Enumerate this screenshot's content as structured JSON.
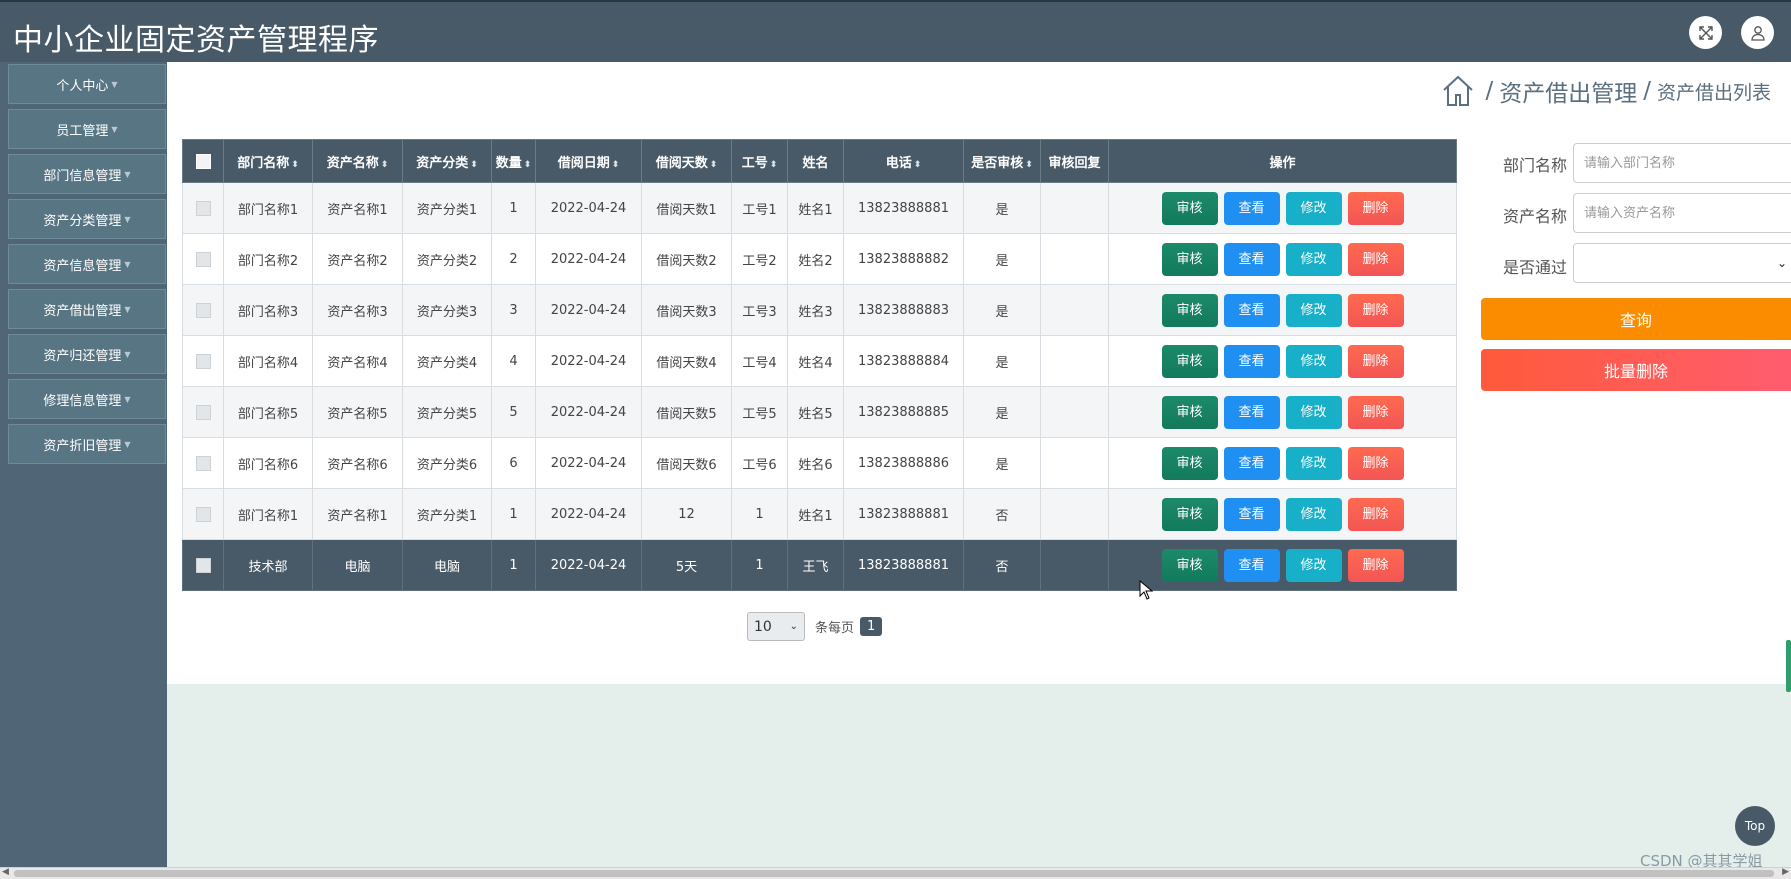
{
  "header": {
    "title": "中小企业固定资产管理程序"
  },
  "sidebar": {
    "items": [
      {
        "label": "个人中心"
      },
      {
        "label": "员工管理"
      },
      {
        "label": "部门信息管理"
      },
      {
        "label": "资产分类管理"
      },
      {
        "label": "资产信息管理"
      },
      {
        "label": "资产借出管理"
      },
      {
        "label": "资产归还管理"
      },
      {
        "label": "修理信息管理"
      },
      {
        "label": "资产折旧管理"
      }
    ]
  },
  "breadcrumb": {
    "section": "资产借出管理",
    "page": "资产借出列表",
    "separator": "/"
  },
  "table": {
    "columns": [
      "部门名称",
      "资产名称",
      "资产分类",
      "数量",
      "借阅日期",
      "借阅天数",
      "工号",
      "姓名",
      "电话",
      "是否审核",
      "审核回复",
      "操作"
    ],
    "sortable": [
      true,
      true,
      true,
      true,
      true,
      true,
      true,
      false,
      true,
      true,
      false,
      false
    ],
    "rows": [
      {
        "cells": [
          "部门名称1",
          "资产名称1",
          "资产分类1",
          "1",
          "2022-04-24",
          "借阅天数1",
          "工号1",
          "姓名1",
          "13823888881",
          "是",
          ""
        ]
      },
      {
        "cells": [
          "部门名称2",
          "资产名称2",
          "资产分类2",
          "2",
          "2022-04-24",
          "借阅天数2",
          "工号2",
          "姓名2",
          "13823888882",
          "是",
          ""
        ]
      },
      {
        "cells": [
          "部门名称3",
          "资产名称3",
          "资产分类3",
          "3",
          "2022-04-24",
          "借阅天数3",
          "工号3",
          "姓名3",
          "13823888883",
          "是",
          ""
        ]
      },
      {
        "cells": [
          "部门名称4",
          "资产名称4",
          "资产分类4",
          "4",
          "2022-04-24",
          "借阅天数4",
          "工号4",
          "姓名4",
          "13823888884",
          "是",
          ""
        ]
      },
      {
        "cells": [
          "部门名称5",
          "资产名称5",
          "资产分类5",
          "5",
          "2022-04-24",
          "借阅天数5",
          "工号5",
          "姓名5",
          "13823888885",
          "是",
          ""
        ]
      },
      {
        "cells": [
          "部门名称6",
          "资产名称6",
          "资产分类6",
          "6",
          "2022-04-24",
          "借阅天数6",
          "工号6",
          "姓名6",
          "13823888886",
          "是",
          ""
        ]
      },
      {
        "cells": [
          "部门名称1",
          "资产名称1",
          "资产分类1",
          "1",
          "2022-04-24",
          "12",
          "1",
          "姓名1",
          "13823888881",
          "否",
          ""
        ]
      },
      {
        "cells": [
          "技术部",
          "电脑",
          "电脑",
          "1",
          "2022-04-24",
          "5天",
          "1",
          "王飞",
          "13823888881",
          "否",
          ""
        ]
      }
    ],
    "actions": {
      "audit": "审核",
      "view": "查看",
      "edit": "修改",
      "delete": "删除"
    }
  },
  "pagination": {
    "page_size": "10",
    "per_page_label": "条每页",
    "current_page": "1"
  },
  "search": {
    "dept_label": "部门名称",
    "dept_placeholder": "请输入部门名称",
    "asset_label": "资产名称",
    "asset_placeholder": "请输入资产名称",
    "pass_label": "是否通过",
    "pass_value": "",
    "query_button": "查询",
    "bulk_delete_button": "批量删除"
  },
  "misc": {
    "top_button": "Top",
    "watermark": "CSDN @其其学姐"
  },
  "colors": {
    "header_bg": "#485a68",
    "sidebar_bg": "#506676",
    "query": "#fb8c00",
    "delete": "#f35555",
    "audit": "#137a5c",
    "view": "#1f90f2",
    "edit": "#17b0c8"
  }
}
